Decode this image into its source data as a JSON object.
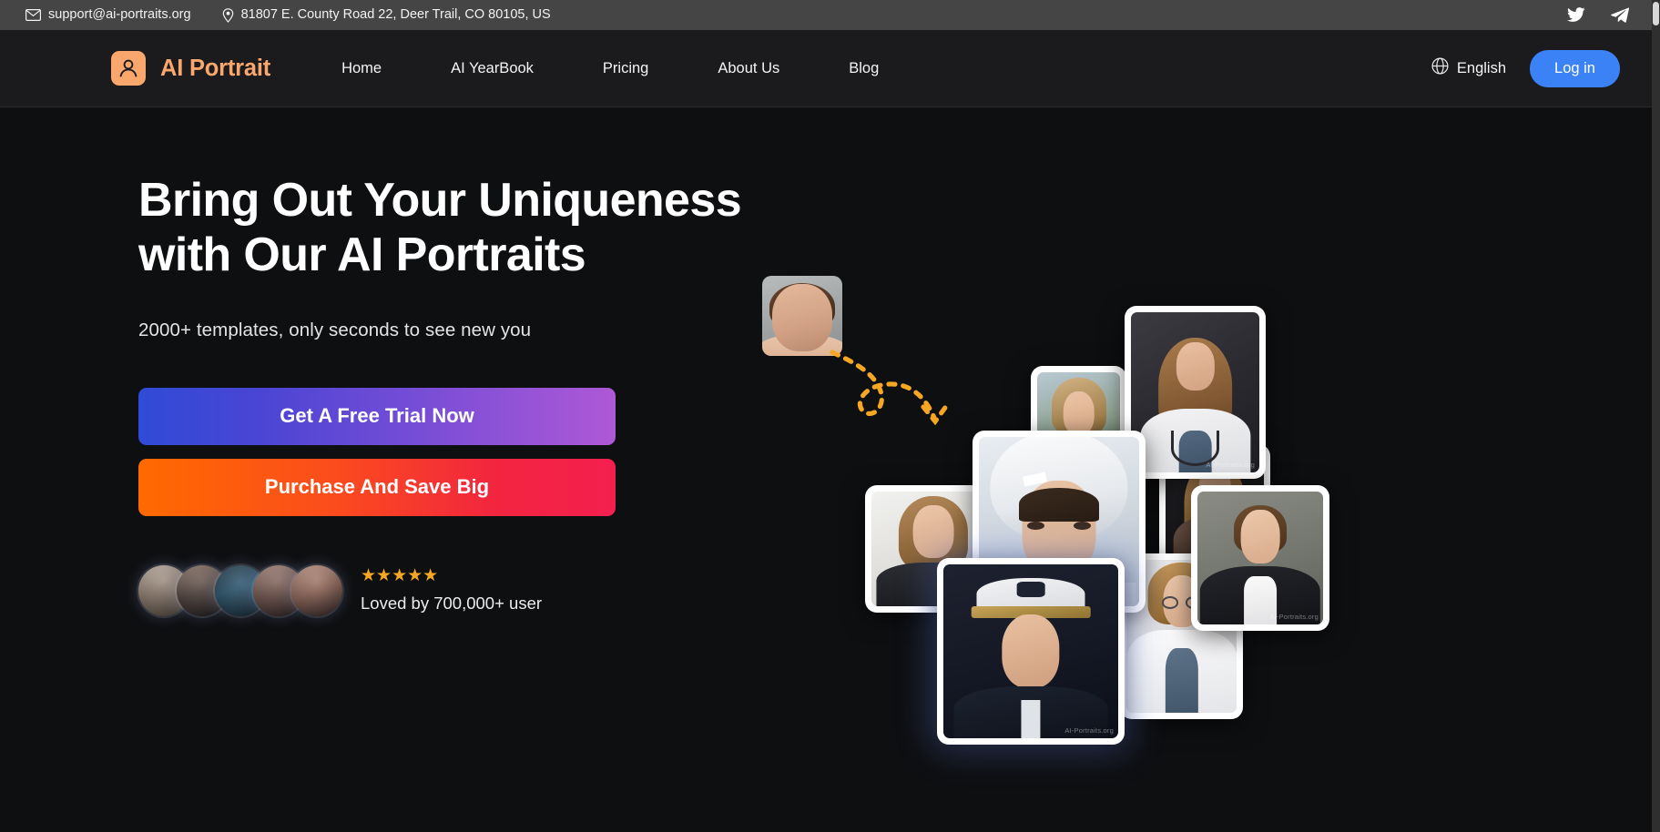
{
  "topbar": {
    "email": "support@ai-portraits.org",
    "email_icon": "envelope-icon",
    "address": "81807 E. County Road 22, Deer Trail, CO 80105, US",
    "address_icon": "location-pin-icon",
    "socials": [
      {
        "name": "twitter-icon",
        "label": "Twitter"
      },
      {
        "name": "telegram-icon",
        "label": "Telegram"
      }
    ],
    "background": "#454545"
  },
  "header": {
    "logo_icon": "user-avatar-icon",
    "brand": "AI Portrait",
    "brand_color": "#f9a76c",
    "nav": [
      {
        "label": "Home"
      },
      {
        "label": "AI YearBook"
      },
      {
        "label": "Pricing"
      },
      {
        "label": "About Us"
      },
      {
        "label": "Blog"
      }
    ],
    "language": "English",
    "language_icon": "globe-icon",
    "login_label": "Log in",
    "login_color": "#3b82f6"
  },
  "hero": {
    "title_line1": "Bring Out Your Uniqueness",
    "title_line2": "with Our AI Portraits",
    "subtitle": "2000+ templates, only seconds to see new you",
    "cta_primary": "Get A Free Trial Now",
    "cta_primary_colors": [
      "#2f4bd6",
      "#ae59d6"
    ],
    "cta_secondary": "Purchase And Save Big",
    "cta_secondary_colors": [
      "#ff6a00",
      "#f41f4f"
    ],
    "rating_stars": "★★★★★",
    "rating_count": 5,
    "rating_color": "#f5a623",
    "loved_text": "Loved by 700,000+ user",
    "avatars": [
      {
        "name": "user-avatar-1"
      },
      {
        "name": "user-avatar-2"
      },
      {
        "name": "user-avatar-3"
      },
      {
        "name": "user-avatar-4"
      },
      {
        "name": "user-avatar-5"
      }
    ]
  },
  "collage": {
    "source_photo_label": "source-portrait-thumbnail",
    "arrow_label": "dashed-curved-arrow",
    "arrow_color": "#f5a623",
    "watermark": "AI-Portraits.org",
    "cards": [
      {
        "id": "card-doctor1",
        "name": "portrait-card-doctor-white-coat",
        "watermark": "AI-Portraits.org"
      },
      {
        "id": "card-pilot",
        "name": "portrait-card-pilot",
        "watermark": ""
      },
      {
        "id": "card-astro",
        "name": "portrait-card-astronaut-helmet",
        "watermark": ""
      },
      {
        "id": "card-guitar",
        "name": "portrait-card-guitarist",
        "watermark": "AI-Portraits.org"
      },
      {
        "id": "card-officer",
        "name": "portrait-card-police-officer",
        "watermark": ""
      },
      {
        "id": "card-suit",
        "name": "portrait-card-business-suit",
        "watermark": "AI-Portraits.org"
      },
      {
        "id": "card-doctor2",
        "name": "portrait-card-doctor-glasses",
        "watermark": ""
      },
      {
        "id": "card-navy",
        "name": "portrait-card-navy-captain",
        "watermark": "AI-Portraits.org"
      }
    ]
  }
}
